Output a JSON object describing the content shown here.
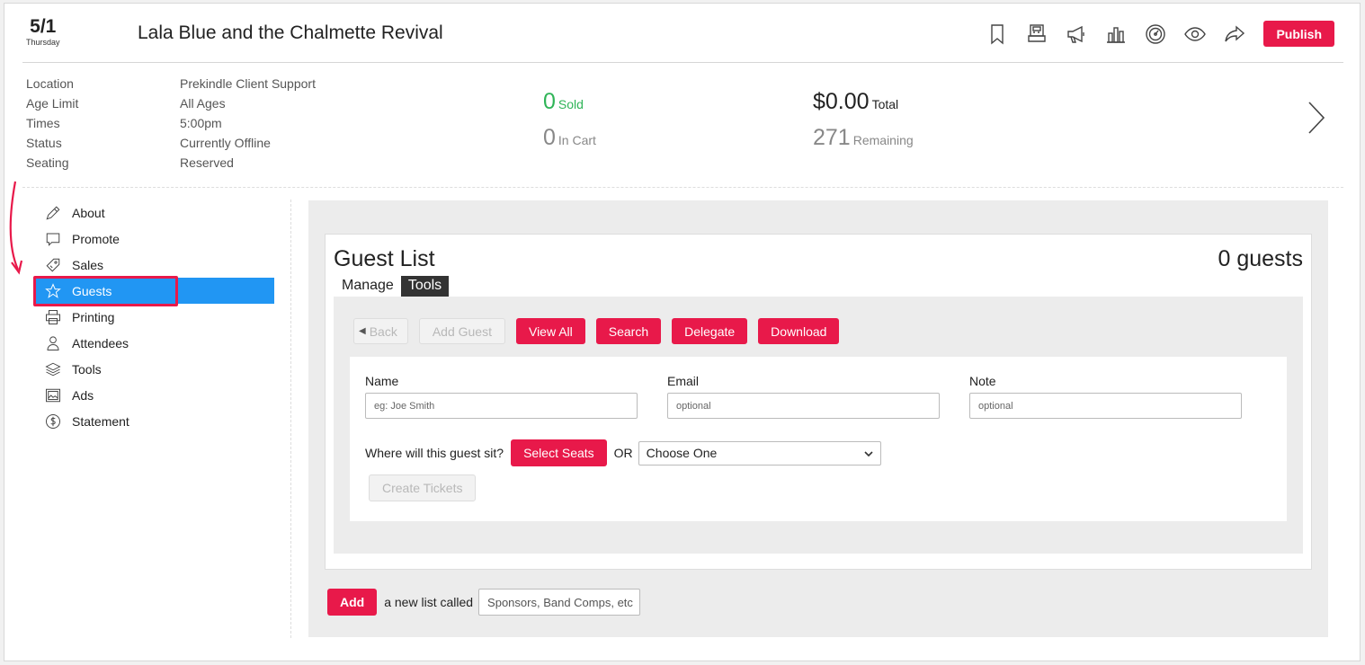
{
  "header": {
    "date_num": "5/1",
    "date_day": "Thursday",
    "event_title": "Lala Blue and the Chalmette Revival",
    "toolbar_icons": [
      "bookmark-icon",
      "register-icon",
      "megaphone-icon",
      "bar-chart-icon",
      "dashboard-icon",
      "eye-icon",
      "share-icon"
    ],
    "publish_label": "Publish"
  },
  "info": {
    "rows": [
      {
        "label": "Location",
        "value": "Prekindle Client Support"
      },
      {
        "label": "Age Limit",
        "value": "All Ages"
      },
      {
        "label": "Times",
        "value": "5:00pm"
      },
      {
        "label": "Status",
        "value": "Currently Offline"
      },
      {
        "label": "Seating",
        "value": "Reserved"
      }
    ]
  },
  "stats": {
    "sold_num": "0",
    "sold_label": "Sold",
    "cart_num": "0",
    "cart_label": "In Cart",
    "total_num": "$0.00",
    "total_label": "Total",
    "remaining_num": "271",
    "remaining_label": "Remaining"
  },
  "sidebar": {
    "items": [
      {
        "label": "About",
        "icon": "pencil-icon"
      },
      {
        "label": "Promote",
        "icon": "speech-bubble-icon"
      },
      {
        "label": "Sales",
        "icon": "tag-icon"
      },
      {
        "label": "Guests",
        "icon": "star-icon"
      },
      {
        "label": "Printing",
        "icon": "printer-icon"
      },
      {
        "label": "Attendees",
        "icon": "person-icon"
      },
      {
        "label": "Tools",
        "icon": "layers-icon"
      },
      {
        "label": "Ads",
        "icon": "image-icon"
      },
      {
        "label": "Statement",
        "icon": "dollar-circle-icon"
      }
    ],
    "active": "Guests"
  },
  "guest_list": {
    "title": "Guest List",
    "count": "0 guests",
    "tabs": [
      "Manage",
      "Tools"
    ],
    "buttons": {
      "back": "Back",
      "add_guest": "Add Guest",
      "view_all": "View All",
      "search": "Search",
      "delegate": "Delegate",
      "download": "Download"
    },
    "form": {
      "name_label": "Name",
      "name_placeholder": "eg: Joe Smith",
      "email_label": "Email",
      "email_placeholder": "optional",
      "note_label": "Note",
      "note_placeholder": "optional",
      "seat_question": "Where will this guest sit?",
      "select_seats": "Select Seats",
      "or": "OR",
      "choose_value": "Choose One",
      "create_tickets": "Create Tickets"
    }
  },
  "add_list": {
    "button": "Add",
    "text": "a new list called",
    "placeholder": "Sponsors, Band Comps, etc"
  },
  "colors": {
    "accent": "#e8194a",
    "active_nav": "#2196f3",
    "sold_green": "#2fb457"
  }
}
